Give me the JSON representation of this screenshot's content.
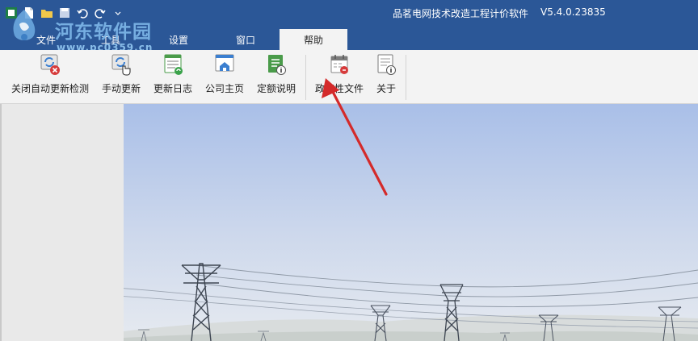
{
  "window": {
    "title": "品茗电网技术改造工程计价软件",
    "version": "V5.4.0.23835"
  },
  "watermark": {
    "line1": "河东软件园",
    "line2": "www.pc0359.cn"
  },
  "tabs": [
    {
      "label": "文件",
      "active": false
    },
    {
      "label": "工具",
      "active": false
    },
    {
      "label": "设置",
      "active": false
    },
    {
      "label": "窗口",
      "active": false
    },
    {
      "label": "帮助",
      "active": true
    }
  ],
  "ribbon": {
    "items": [
      {
        "label": "关闭自动更新检测",
        "icon": "disable-update-icon"
      },
      {
        "label": "手动更新",
        "icon": "manual-update-icon"
      },
      {
        "label": "更新日志",
        "icon": "update-log-icon"
      },
      {
        "label": "公司主页",
        "icon": "homepage-icon"
      },
      {
        "label": "定额说明",
        "icon": "quota-info-icon"
      },
      {
        "label": "政策性文件",
        "icon": "policy-doc-icon"
      },
      {
        "label": "关于",
        "icon": "about-icon"
      }
    ]
  },
  "colors": {
    "titlebar": "#2b5797",
    "ribbon": "#f3f3f3",
    "annotation_arrow": "#d42a2a",
    "sky_top": "#a9bfe8",
    "sky_bottom": "#e6eaf0"
  }
}
